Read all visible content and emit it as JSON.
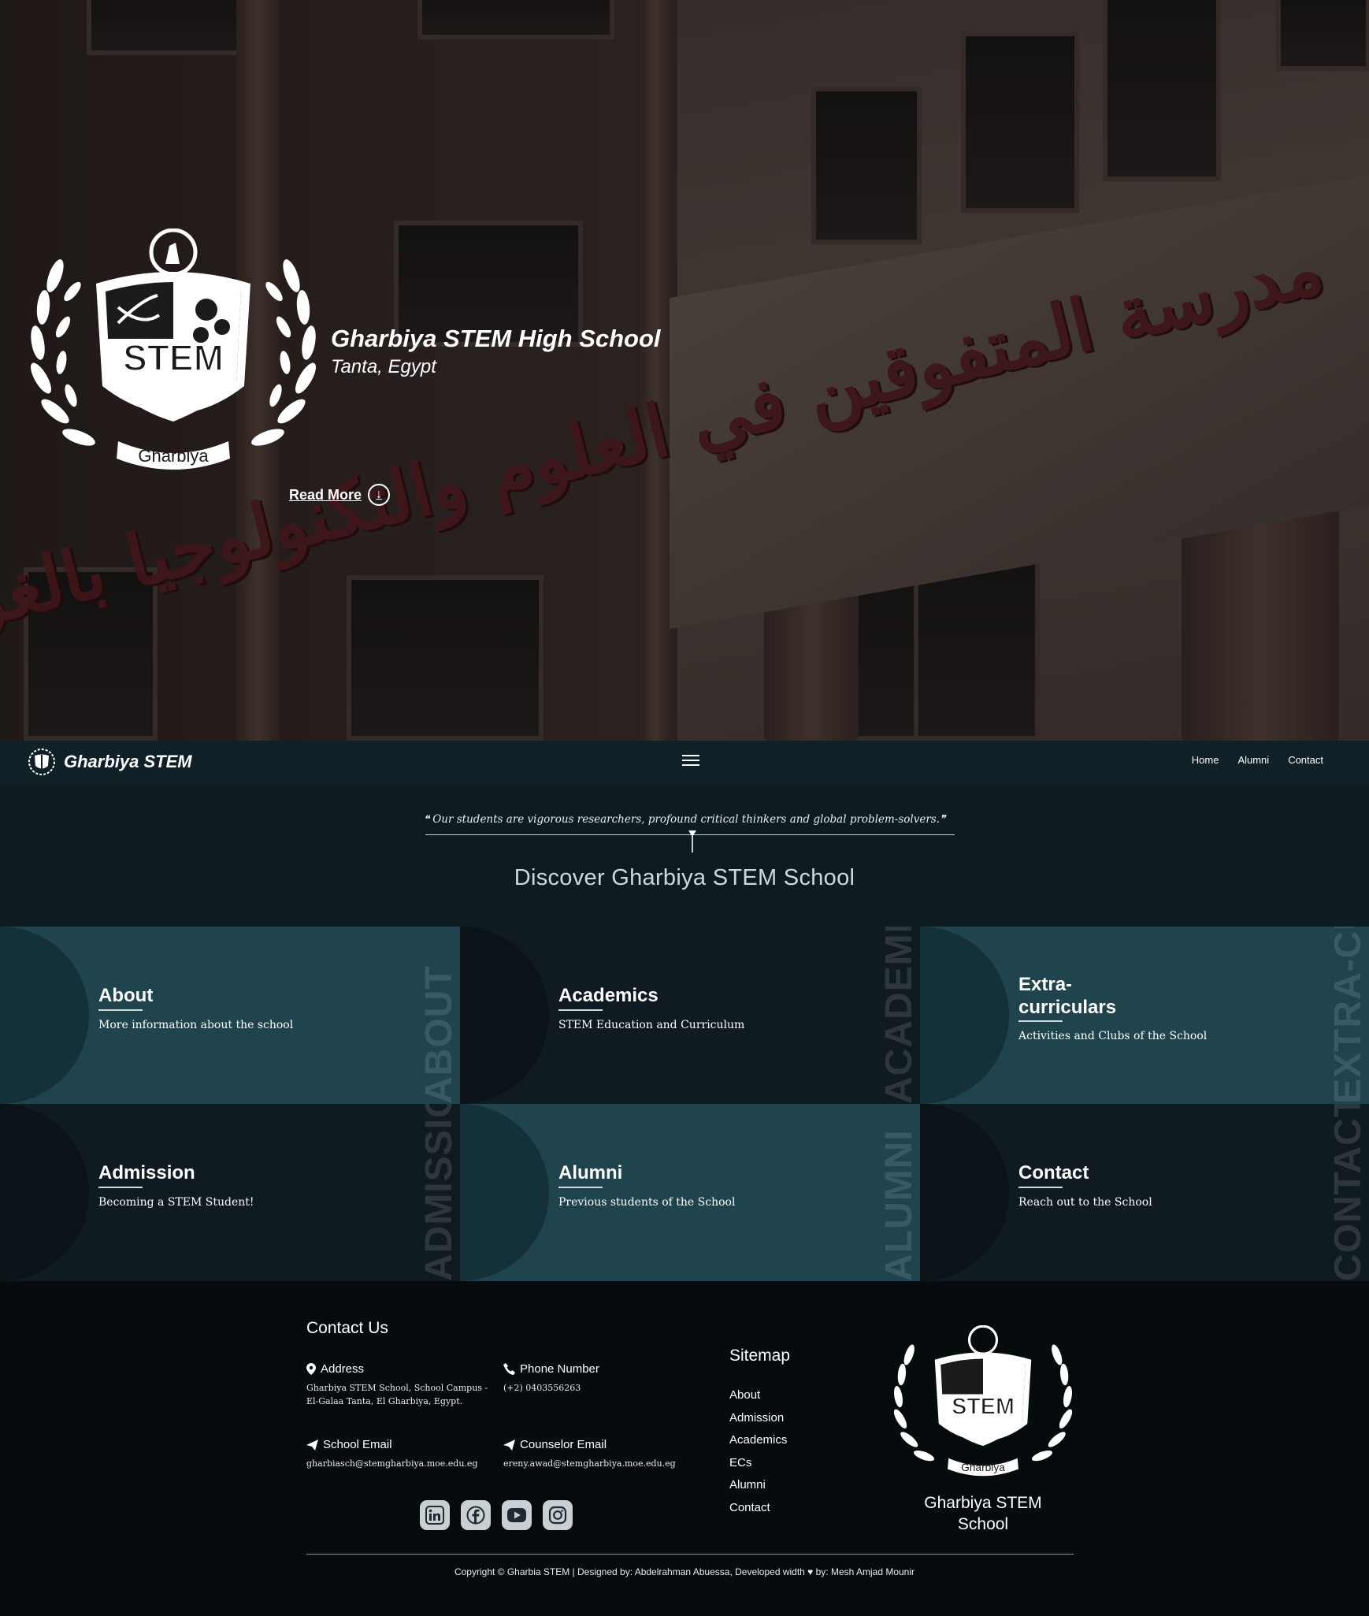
{
  "hero": {
    "sign_text": "مدرسة المتفوقين في العلوم والتكنولوجيا بالغربية",
    "crest_top_text": "STEM",
    "crest_ribbon_text": "Gharbiya",
    "title": "Gharbiya STEM High School",
    "subtitle": "Tanta, Egypt",
    "read_more": "Read More",
    "read_more_icon": "↓"
  },
  "navbar": {
    "brand": "Gharbiya STEM",
    "links": [
      "Home",
      "Alumni",
      "Contact"
    ]
  },
  "discover": {
    "quote": "❝ Our students are vigorous researchers, profound critical thinkers and global problem-solvers.❞",
    "title": "Discover Gharbiya STEM School"
  },
  "cards": [
    {
      "title": "About",
      "desc": "More information about the school",
      "vertical": "ABOUT"
    },
    {
      "title": "Academics",
      "desc": "STEM Education and Curriculum",
      "vertical": "ACADEMICS"
    },
    {
      "title": "Extra-curriculars",
      "title_line1": "Extra-",
      "title_line2": "curriculars",
      "desc": "Activities and Clubs of the School",
      "vertical": "EXTRA-CURRICULARS"
    },
    {
      "title": "Admission",
      "desc": "Becoming a STEM Student!",
      "vertical": "ADMISSION"
    },
    {
      "title": "Alumni",
      "desc": "Previous students of the School",
      "vertical": "ALUMNI"
    },
    {
      "title": "Contact",
      "desc": "Reach out to the School",
      "vertical": "CONTACT"
    }
  ],
  "footer": {
    "contact_heading": "Contact Us",
    "address_label": "Address",
    "address_line1": "Gharbiya STEM School, School Campus -",
    "address_line2": "El-Galaa Tanta, El Gharbiya, Egypt.",
    "phone_label": "Phone Number",
    "phone_value": "(+2) 0403556263",
    "school_email_label": "School Email",
    "school_email_value": "gharbiasch@stemgharbiya.moe.edu.eg",
    "counselor_email_label": "Counselor Email",
    "counselor_email_value": "ereny.awad@stemgharbiya.moe.edu.eg",
    "sitemap_heading": "Sitemap",
    "sitemap": [
      "About",
      "Admission",
      "Academics",
      "ECs",
      "Alumni",
      "Contact"
    ],
    "brand_line1": "Gharbiya STEM",
    "brand_line2": "School",
    "copyright": "Copyright © Gharbia STEM | Designed by: Abdelrahman Abuessa, Developed width ♥ by: Mesh Amjad Mounir"
  }
}
